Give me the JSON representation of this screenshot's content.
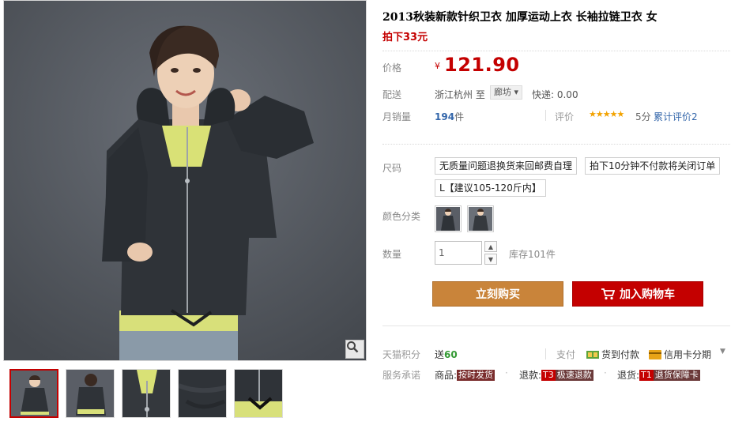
{
  "product": {
    "title": "2013秋装新款针织卫衣 加厚运动上衣 长袖拉链卫衣 女",
    "subtitle": "拍下33元"
  },
  "price": {
    "label": "价格",
    "currency": "¥",
    "value": "121.90"
  },
  "shipping": {
    "label": "配送",
    "from": "浙江杭州 至",
    "to": "廊坊",
    "fee": "快递: 0.00"
  },
  "sales": {
    "label": "月销量",
    "count": "194",
    "unit": "件",
    "rating_label": "评价",
    "stars": "★★★★★",
    "score": "5分",
    "reviews_link": "累计评价2"
  },
  "options": {
    "size_label": "尺码",
    "sizes": [
      "无质量问题退换货来回邮费自理",
      "拍下10分钟不付款将关闭订单",
      "L【建议105-120斤内】"
    ],
    "color_label": "颜色分类",
    "quantity_label": "数量",
    "quantity_value": "1",
    "stock": "库存101件"
  },
  "actions": {
    "buy_now": "立刻购买",
    "add_to_cart": "加入购物车"
  },
  "services": {
    "points_label": "天猫积分",
    "points_prefix": "送",
    "points_value": "60",
    "pay_label": "支付",
    "pay_cod": "货到付款",
    "pay_credit": "信用卡分期",
    "promise_label": "服务承诺",
    "promise_goods_prefix": "商品:",
    "promise_goods_tag": "按时发货",
    "promise_refund_prefix": "退款:",
    "promise_refund_code": "T3",
    "promise_refund_tag": "极速退款",
    "promise_return_prefix": "退货:",
    "promise_return_code": "T1",
    "promise_return_tag": "退货保障卡"
  },
  "colors": {
    "price_red": "#c40000",
    "buy_orange": "#c9843a",
    "cart_red": "#c40000",
    "link_blue": "#3366aa",
    "star_gold": "#f2a200",
    "points_green": "#339933"
  },
  "icons": [
    "zoom-icon",
    "cart-icon",
    "cod-icon",
    "credit-card-icon",
    "chevron-down-icon"
  ]
}
